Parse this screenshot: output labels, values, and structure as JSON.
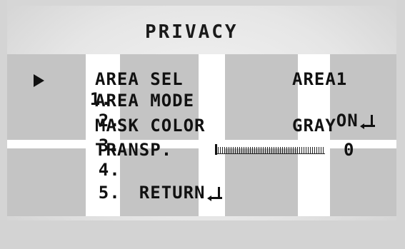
{
  "menu": {
    "title": "PRIVACY",
    "items": [
      {
        "number": "1.",
        "label": "AREA SEL",
        "value": "AREA1",
        "selected": true
      },
      {
        "number": "2.",
        "label": "AREA MODE",
        "value": "ON",
        "value_has_enter": true
      },
      {
        "number": "3.",
        "label": "MASK COLOR",
        "value": "GRAY"
      },
      {
        "number": "4.",
        "label": "TRANSP.",
        "value": "0",
        "level": 0
      },
      {
        "number": "5.",
        "label": "RETURN",
        "label_has_enter": true
      }
    ]
  },
  "icons": {
    "cursor": "triangle-right-cursor-icon",
    "enter": "enter-return-icon"
  },
  "colors": {
    "text": "#111111",
    "mask": "#c4c4c4",
    "background": "#ffffff"
  }
}
